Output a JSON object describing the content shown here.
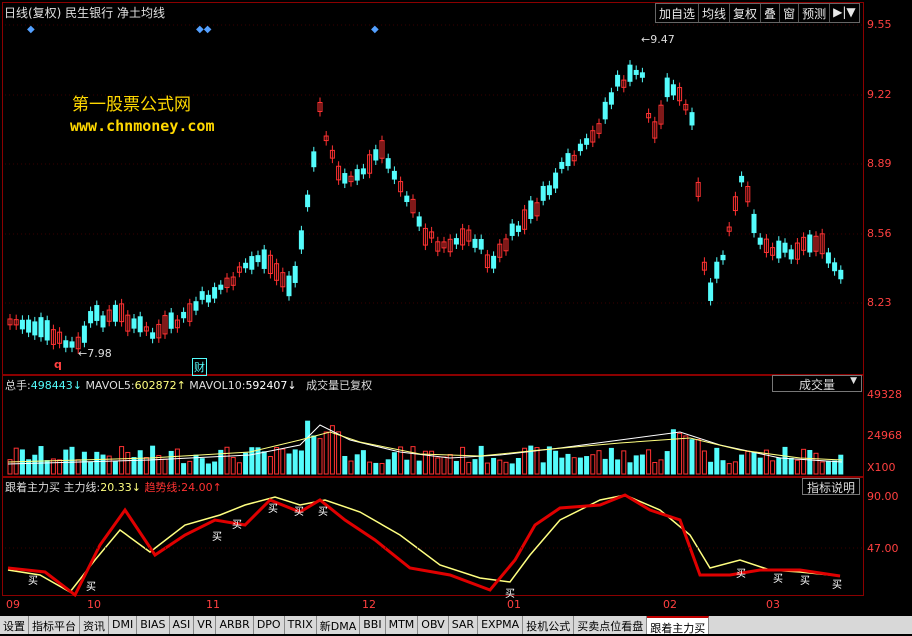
{
  "header": {
    "title": "日线(复权)  民生银行  净土均线"
  },
  "toolbar": {
    "buttons": [
      "加自选",
      "均线",
      "复权",
      "叠",
      "窗",
      "预测",
      "▶|▼"
    ]
  },
  "watermark": {
    "line1": "第一股票公式网",
    "line2": "www.chnmoney.com"
  },
  "price_axis": [
    "9.55",
    "9.22",
    "8.89",
    "8.56",
    "8.23"
  ],
  "annotations": {
    "high": "9.47",
    "low": "7.98",
    "mark_q": "q",
    "mark_cai": "财"
  },
  "volume": {
    "total_label": "总手:",
    "total": "498443↓",
    "mavol5_label": "MAVOL5:",
    "mavol5": "602872↑",
    "mavol10_label": "MAVOL10:",
    "mavol10": "592407↓",
    "note": "成交量已复权",
    "dropdown": "成交量",
    "axis": [
      "49328",
      "24968",
      "X100"
    ]
  },
  "indicator": {
    "name": "跟着主力买",
    "main_label": "主力线:",
    "main_value": "20.33↓",
    "trend_label": "趋势线:",
    "trend_value": "24.00↑",
    "help_button": "指标说明",
    "axis": [
      "90.00",
      "47.00"
    ],
    "buy_marks": [
      "买",
      "买",
      "买",
      "买",
      "买",
      "买",
      "买",
      "买",
      "买",
      "买",
      "买",
      "买"
    ]
  },
  "months": [
    "09",
    "10",
    "11",
    "12",
    "01",
    "02",
    "03"
  ],
  "tabs": [
    "设置",
    "指标平台",
    "资讯",
    "DMI",
    "BIAS",
    "ASI",
    "VR",
    "ARBR",
    "DPO",
    "TRIX",
    "新DMA",
    "BBI",
    "MTM",
    "OBV",
    "SAR",
    "EXPMA",
    "投机公式",
    "买卖点位看盘",
    "跟着主力买"
  ],
  "active_tab": "跟着主力买",
  "colors": {
    "up": "#ff3232",
    "down": "#54fcfc",
    "ma": "#ffffff",
    "main_line": "#ffff80",
    "trend_line": "#e00000",
    "axis": "#ff4040"
  }
}
